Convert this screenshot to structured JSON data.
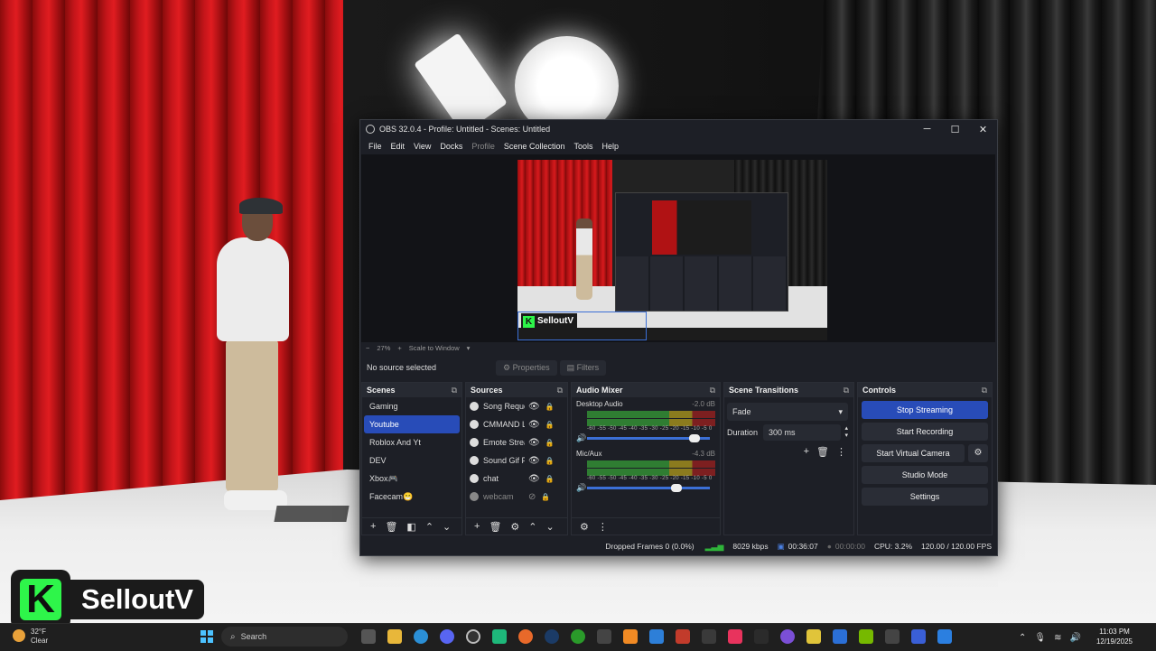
{
  "window": {
    "title": "OBS 32.0.4 - Profile: Untitled - Scenes: Untitled",
    "controls": {
      "minimize": "─",
      "maximize": "☐",
      "close": "✕"
    }
  },
  "menu": [
    "File",
    "Edit",
    "View",
    "Docks",
    "Profile",
    "Scene Collection",
    "Tools",
    "Help"
  ],
  "preview": {
    "logo_text": "SelloutV",
    "zoom": "27%",
    "zoom_minus": "−",
    "zoom_plus": "+",
    "scale_mode": "Scale to Window"
  },
  "source_bar": {
    "status": "No source selected",
    "properties": "Properties",
    "filters": "Filters"
  },
  "scenes": {
    "title": "Scenes",
    "items": [
      "Gaming",
      "Youtube",
      "Roblox And Yt",
      "DEV",
      "Xbox🎮",
      "Facecam😁"
    ],
    "active_index": 1
  },
  "sources": {
    "title": "Sources",
    "items": [
      {
        "name": "Song Reque",
        "visible": true
      },
      {
        "name": "CMMAND L",
        "visible": true
      },
      {
        "name": "Emote Strea",
        "visible": true
      },
      {
        "name": "Sound Gif P",
        "visible": true
      },
      {
        "name": "chat",
        "visible": true
      },
      {
        "name": "webcam",
        "visible": false
      }
    ]
  },
  "audio_mixer": {
    "title": "Audio Mixer",
    "scale": "-60 -55 -50 -45 -40 -35 -30 -25 -20 -15 -10 -5 0",
    "channels": [
      {
        "name": "Desktop Audio",
        "db": "-2.0 dB",
        "volume": 0.92
      },
      {
        "name": "Mic/Aux",
        "db": "-4.3 dB",
        "volume": 0.77
      }
    ]
  },
  "transitions": {
    "title": "Scene Transitions",
    "selected": "Fade",
    "duration_label": "Duration",
    "duration_value": "300 ms"
  },
  "controls": {
    "title": "Controls",
    "stop_streaming": "Stop Streaming",
    "start_recording": "Start Recording",
    "start_virtual_camera": "Start Virtual Camera",
    "studio_mode": "Studio Mode",
    "settings": "Settings"
  },
  "status": {
    "dropped_frames": "Dropped Frames 0 (0.0%)",
    "bitrate": "8029 kbps",
    "stream_time": "00:36:07",
    "record_time": "00:00:00",
    "cpu": "CPU: 3.2%",
    "fps": "120.00 / 120.00 FPS"
  },
  "overlay": {
    "logo_text": "SelloutV",
    "logo_letter": "K"
  },
  "taskbar": {
    "weather_temp": "32°F",
    "weather_desc": "Clear",
    "search_placeholder": "Search",
    "time": "11:03 PM",
    "date": "12/19/2025"
  },
  "colors": {
    "accent": "#284cb8",
    "obs_bg": "#1d1f26",
    "logo_green": "#2ef54a"
  }
}
